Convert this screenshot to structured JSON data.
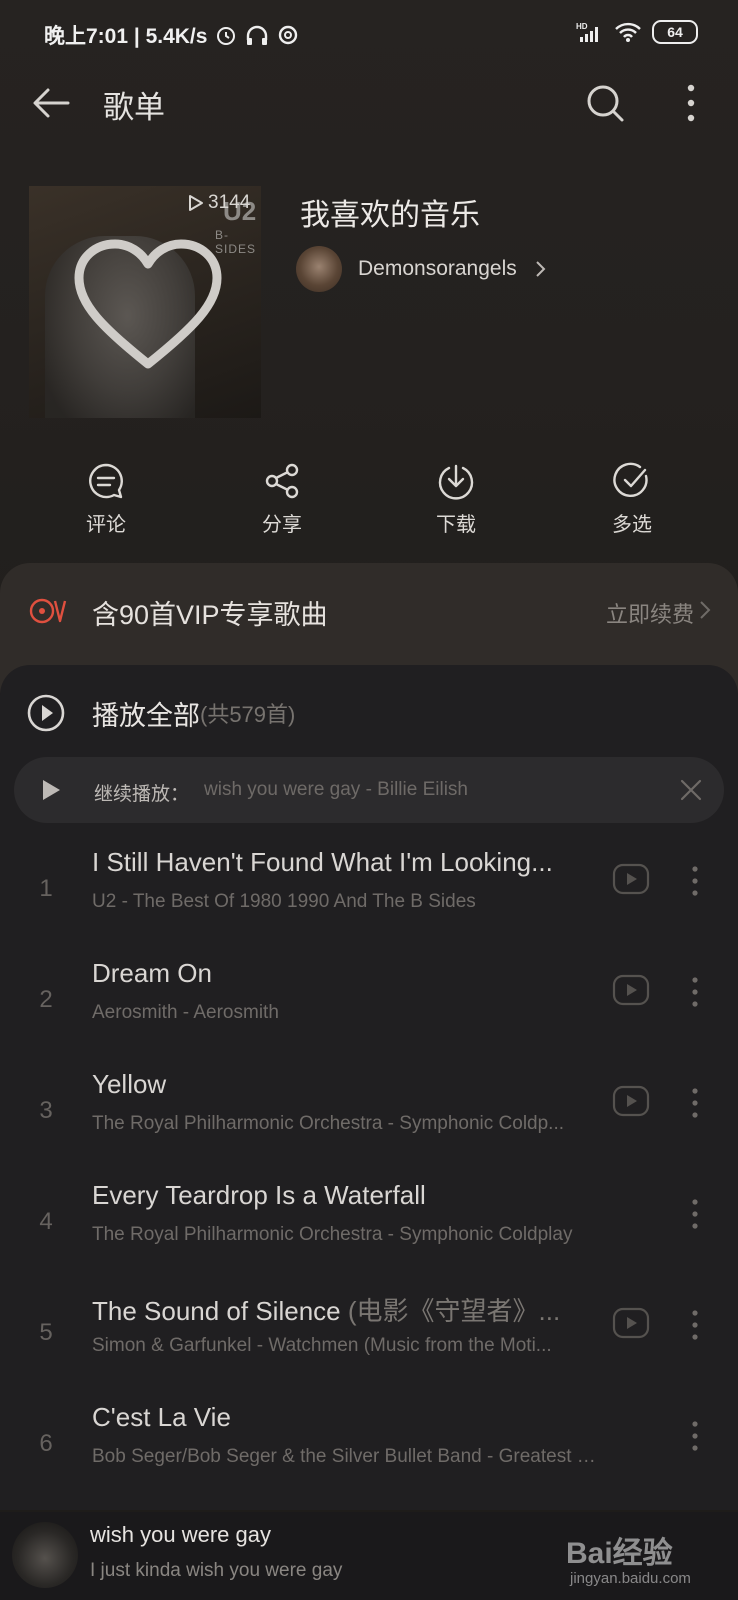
{
  "status_bar": {
    "time_speed": "晚上7:01 | 5.4K/s",
    "battery": "64",
    "network": "HD"
  },
  "header": {
    "title": "歌单"
  },
  "playlist": {
    "play_count": "3144",
    "title": "我喜欢的音乐",
    "creator": "Demonsorangels",
    "cover_text_1": "U2",
    "cover_text_2": "B-SIDES"
  },
  "actions": [
    {
      "label": "评论",
      "icon": "comment-icon"
    },
    {
      "label": "分享",
      "icon": "share-icon"
    },
    {
      "label": "下载",
      "icon": "download-icon"
    },
    {
      "label": "多选",
      "icon": "multiselect-icon"
    }
  ],
  "vip": {
    "text": "含90首VIP专享歌曲",
    "action": "立即续费",
    "accent": "#e0503f"
  },
  "play_all": {
    "label": "播放全部",
    "count": "(共579首)"
  },
  "continue_play": {
    "label": "继续播放：",
    "track": "wish you were gay - Billie Eilish"
  },
  "songs": [
    {
      "num": "1",
      "title": "I Still Haven't Found What I'm Looking...",
      "title_extra": "",
      "meta": "U2 - The Best Of 1980 1990 And The B Sides",
      "has_mv": true
    },
    {
      "num": "2",
      "title": "Dream On",
      "title_extra": "",
      "meta": "Aerosmith - Aerosmith",
      "has_mv": true
    },
    {
      "num": "3",
      "title": "Yellow",
      "title_extra": "",
      "meta": "The Royal Philharmonic Orchestra - Symphonic Coldp...",
      "has_mv": true
    },
    {
      "num": "4",
      "title": "Every Teardrop Is a Waterfall",
      "title_extra": "",
      "meta": "The Royal Philharmonic Orchestra - Symphonic Coldplay",
      "has_mv": false
    },
    {
      "num": "5",
      "title": "The Sound of Silence ",
      "title_extra": "(电影《守望者》...",
      "meta": "Simon & Garfunkel - Watchmen (Music from the Moti...",
      "has_mv": true
    },
    {
      "num": "6",
      "title": "C'est La Vie",
      "title_extra": "",
      "meta": "Bob Seger/Bob Seger & the Silver Bullet Band - Greatest Hits",
      "has_mv": false
    }
  ],
  "mini_player": {
    "title": "wish you were gay",
    "subtitle": "I just kinda wish you were gay"
  },
  "watermark": {
    "title": "Bai经验",
    "url": "jingyan.baidu.com"
  }
}
